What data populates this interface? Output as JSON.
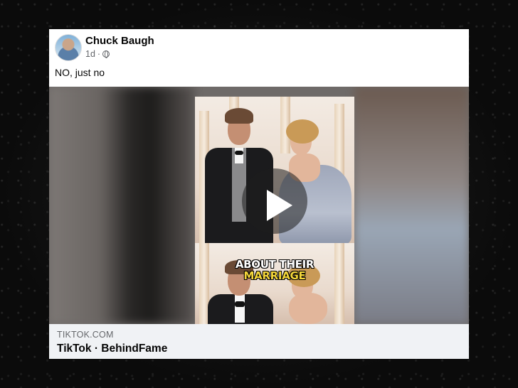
{
  "post": {
    "author": "Chuck Baugh",
    "time": "1d",
    "separator": "·",
    "privacy_icon": "globe-icon",
    "text": "NO, just no"
  },
  "video": {
    "caption_line1": "ABOUT THEIR",
    "caption_line2": "MARRIAGE",
    "play_icon": "play-icon",
    "caption_colors": {
      "line1": "#ffffff",
      "line2": "#f4d63a"
    }
  },
  "link": {
    "domain": "TIKTOK.COM",
    "title": "TikTok · BehindFame"
  }
}
